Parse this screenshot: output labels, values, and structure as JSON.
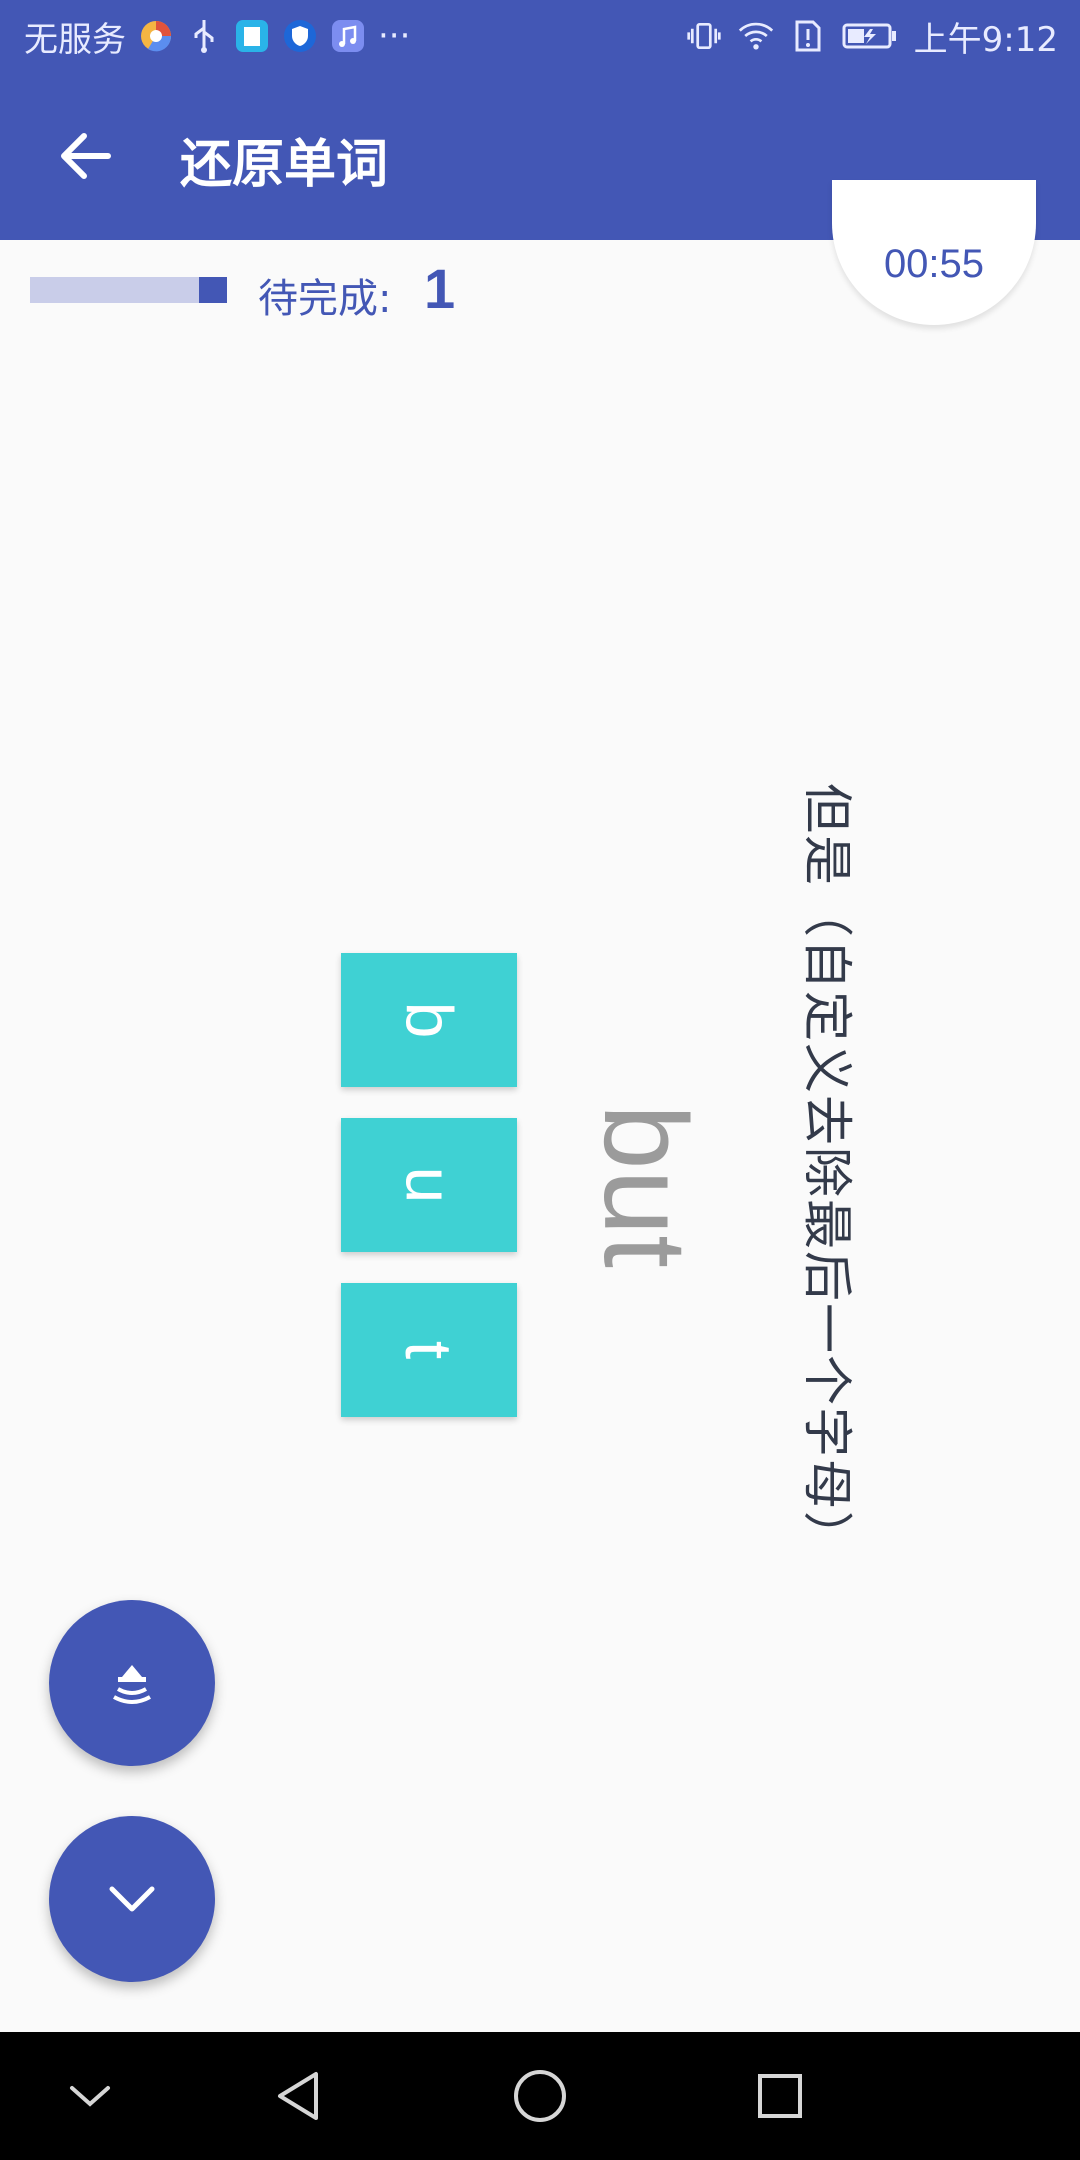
{
  "status_bar": {
    "carrier": "无服务",
    "more": "···",
    "time": "上午9:12",
    "icons": [
      "browser-icon",
      "usb-icon",
      "book-app-icon",
      "shield-app-icon",
      "music-app-icon",
      "vibrate-icon",
      "wifi-icon",
      "no-sim-icon",
      "battery-charging-icon"
    ]
  },
  "app_bar": {
    "title": "还原单词",
    "back_icon": "arrow-back-icon"
  },
  "progress": {
    "label": "待完成:",
    "count": "1",
    "fraction_complete": 0.14
  },
  "timer": {
    "value": "00:55"
  },
  "letters": [
    "b",
    "u",
    "t"
  ],
  "word": "but",
  "meaning": "但是（自定义去除最后一个字母）",
  "fabs": [
    {
      "name": "speaker-icon"
    },
    {
      "name": "chevron-down-icon"
    }
  ],
  "nav_bar": [
    "collapse-icon",
    "back-triangle-icon",
    "home-circle-icon",
    "recents-square-icon"
  ],
  "colors": {
    "primary": "#4357b5",
    "tile": "#3fd1d3",
    "background": "#fafafa"
  }
}
